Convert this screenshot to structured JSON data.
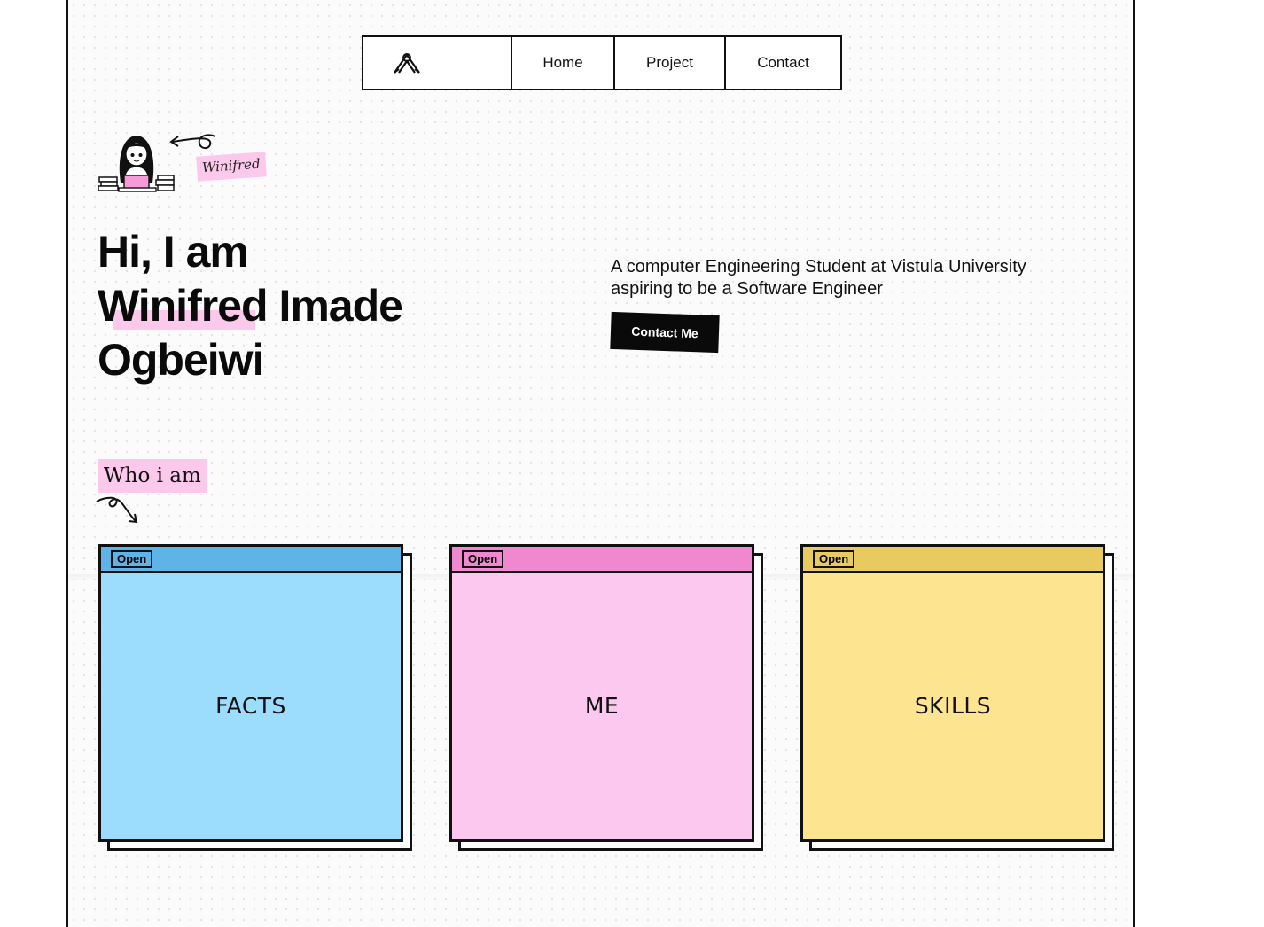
{
  "colors": {
    "highlight_pink": "#fcc8ec",
    "black": "#0a0a0a",
    "facts_bar": "#5eb4e6",
    "facts_body": "#9cdcfc",
    "me_bar": "#f088d0",
    "me_body": "#fcc8f0",
    "skills_bar": "#e8ca60",
    "skills_body": "#fde490"
  },
  "nav": {
    "logo_icon": "stacked-chevron-logo-icon",
    "links": [
      "Home",
      "Project",
      "Contact"
    ]
  },
  "intro": {
    "avatar_icon": "girl-at-laptop-avatar-icon",
    "name_tag": "Winifred"
  },
  "hero": {
    "line1": "Hi, I am",
    "name_highlight": "Winifred",
    "name_rest": " Imade",
    "line3": "Ogbeiwi",
    "description": "A computer Engineering Student at Vistula University aspiring to be a Software Engineer",
    "cta_label": "Contact Me"
  },
  "who": {
    "label": "Who i am"
  },
  "cards": [
    {
      "badge": "Open",
      "title": "FACTS"
    },
    {
      "badge": "Open",
      "title": "ME"
    },
    {
      "badge": "Open",
      "title": "SKILLS"
    }
  ]
}
